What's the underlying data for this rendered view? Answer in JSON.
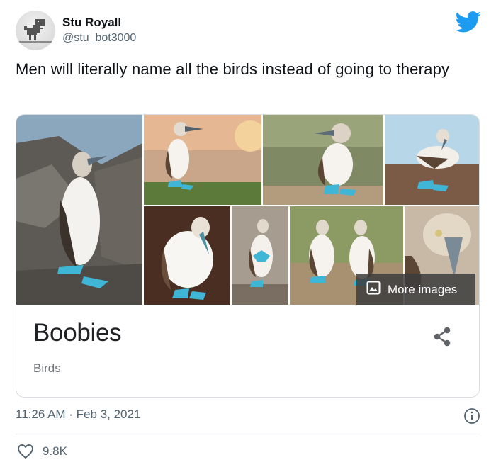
{
  "tweet": {
    "author_name": "Stu Royall",
    "author_handle": "@stu_bot3000",
    "text": "Men will literally name all the birds instead of going to therapy",
    "timestamp": "11:26 AM · Feb 3, 2021",
    "likes": "9.8K"
  },
  "card": {
    "title": "Boobies",
    "subtitle": "Birds",
    "more_images_label": "More images"
  },
  "icons": {
    "brand": "twitter-bird-icon",
    "share": "share-icon",
    "info": "info-icon",
    "like": "heart-icon",
    "more_images": "image-icon"
  },
  "colors": {
    "brand_blue": "#1d9bf0",
    "secondary_text": "#536471",
    "booby_feet": "#3fb6d6"
  }
}
